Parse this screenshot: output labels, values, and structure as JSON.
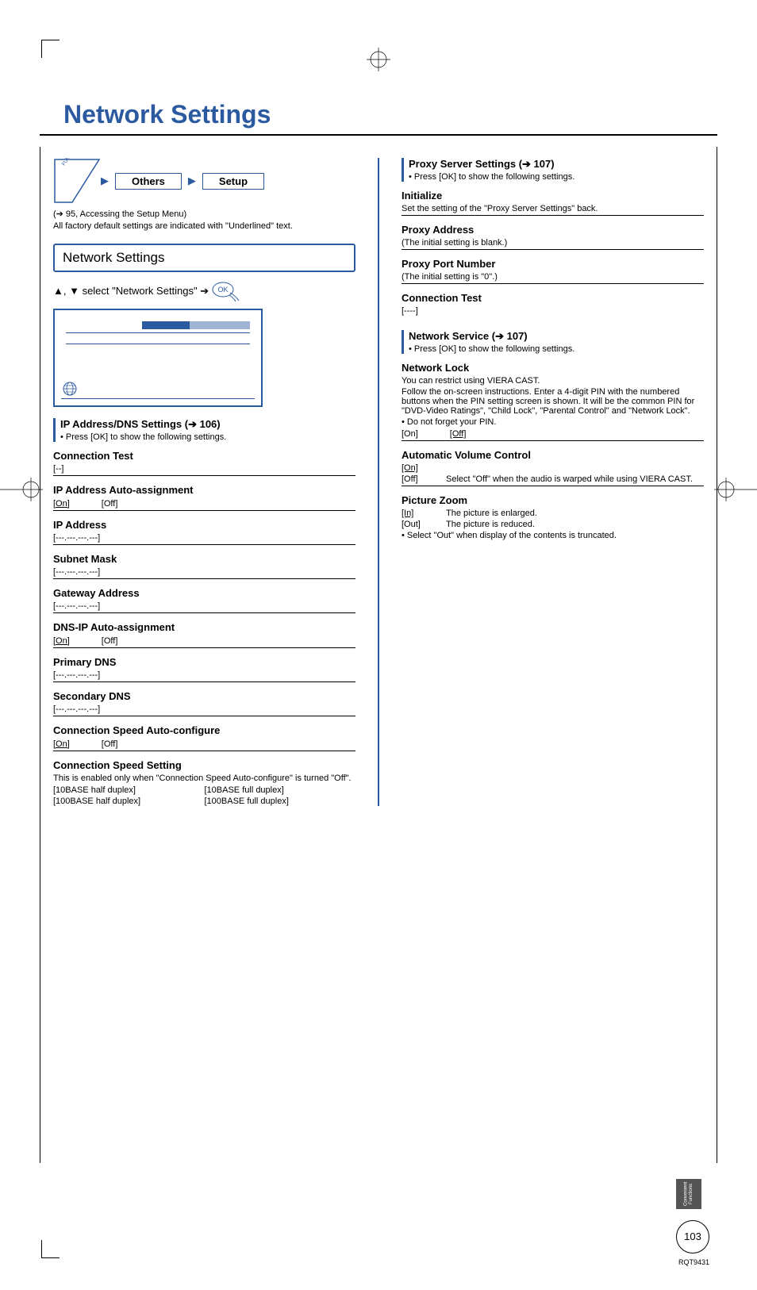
{
  "page_title": "Network Settings",
  "breadcrumb": {
    "item1": "Others",
    "item2": "Setup"
  },
  "setup_ref": "(➔ 95, Accessing the Setup Menu)",
  "default_note": "All factory default settings are indicated with \"Underlined\" text.",
  "section_chip": "Network Settings",
  "nav_instruction_pre": "▲, ▼ select \"Network Settings\" ➔",
  "ok_label": "OK",
  "func_menu_label": "FUNCTION MENU",
  "ip_dns_heading": "IP Address/DNS Settings (➔ 106)",
  "press_ok_note": "• Press [OK] to show the following settings.",
  "settings_left": {
    "conn_test": {
      "title": "Connection Test",
      "val": "[--]"
    },
    "ip_auto": {
      "title": "IP Address Auto-assignment",
      "on": "[On]",
      "off": "[Off]"
    },
    "ip_addr": {
      "title": "IP Address",
      "val": "[---.---.---.---]"
    },
    "subnet": {
      "title": "Subnet Mask",
      "val": "[---.---.---.---]"
    },
    "gateway": {
      "title": "Gateway Address",
      "val": "[---.---.---.---]"
    },
    "dns_auto": {
      "title": "DNS-IP Auto-assignment",
      "on": "[On]",
      "off": "[Off]"
    },
    "pri_dns": {
      "title": "Primary DNS",
      "val": "[---.---.---.---]"
    },
    "sec_dns": {
      "title": "Secondary DNS",
      "val": "[---.---.---.---]"
    },
    "speed_auto": {
      "title": "Connection Speed Auto-configure",
      "on": "[On]",
      "off": "[Off]"
    },
    "speed_set": {
      "title": "Connection Speed Setting",
      "note": "This is enabled only when \"Connection Speed Auto-configure\" is turned \"Off\".",
      "o1": "[10BASE half duplex]",
      "o2": "[10BASE full duplex]",
      "o3": "[100BASE half duplex]",
      "o4": "[100BASE full duplex]"
    }
  },
  "proxy_heading": "Proxy Server Settings (➔ 107)",
  "proxy": {
    "init": {
      "title": "Initialize",
      "desc": "Set the setting of the \"Proxy Server Settings\" back."
    },
    "addr": {
      "title": "Proxy Address",
      "desc": "(The initial setting is blank.)"
    },
    "port": {
      "title": "Proxy Port Number",
      "desc": "(The initial setting is \"0\".)"
    },
    "test": {
      "title": "Connection Test",
      "val": "[----]"
    }
  },
  "netsvc_heading": "Network Service (➔ 107)",
  "netsvc": {
    "lock": {
      "title": "Network Lock",
      "l1": "You can restrict using VIERA CAST.",
      "l2": "Follow the on-screen instructions. Enter a 4-digit PIN with the numbered buttons when the PIN setting screen is shown. It will be the common PIN for \"DVD-Video Ratings\", \"Child Lock\", \"Parental Control\" and \"Network Lock\".",
      "l3": "• Do not forget your PIN.",
      "on": "[On]",
      "off": "[Off]"
    },
    "avc": {
      "title": "Automatic Volume Control",
      "on": "[On]",
      "off": "[Off]",
      "off_desc": "Select \"Off\" when the audio is warped while using VIERA CAST."
    },
    "zoom": {
      "title": "Picture Zoom",
      "in_lbl": "[In]",
      "in_desc": "The picture is enlarged.",
      "out_lbl": "[Out]",
      "out_desc": "The picture is reduced.",
      "note": "• Select \"Out\" when display of the contents is truncated."
    }
  },
  "side_tab": "Convenient Functions",
  "page_number": "103",
  "doc_id": "RQT9431"
}
